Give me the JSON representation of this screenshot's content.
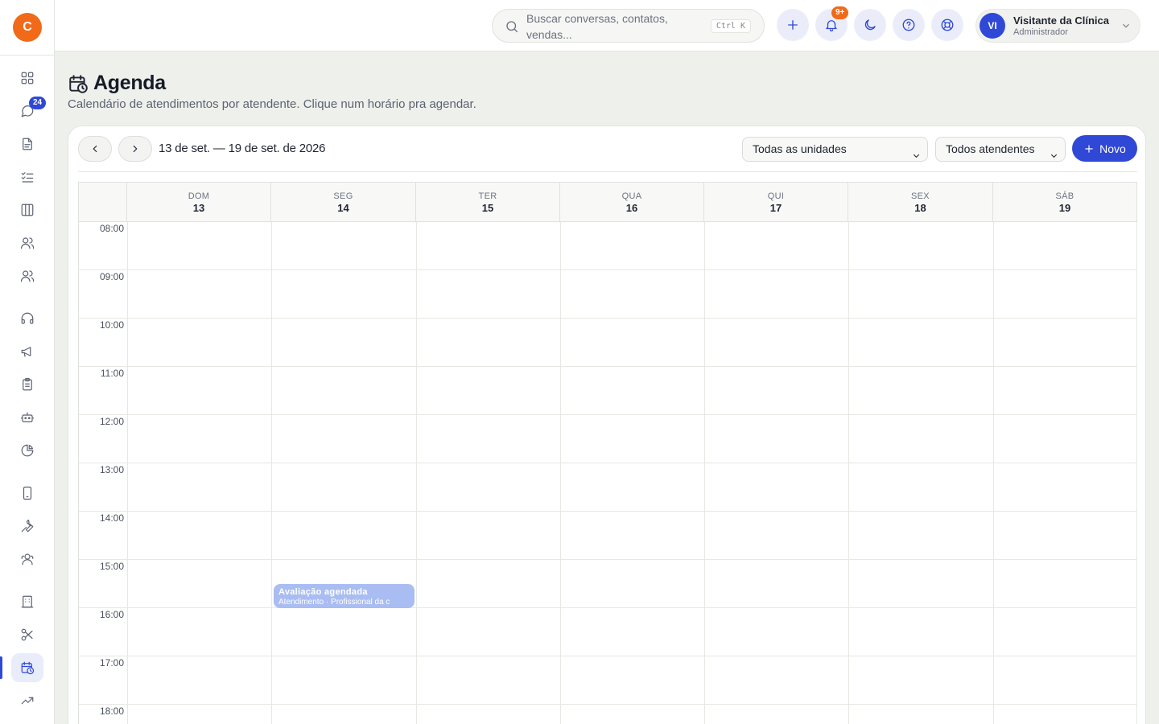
{
  "sidebar": {
    "logo_letter": "C",
    "chat_badge": "24",
    "items": [
      {
        "icon": "dashboard-icon"
      },
      {
        "icon": "chat-icon"
      },
      {
        "icon": "document-icon"
      },
      {
        "icon": "checklist-icon"
      },
      {
        "icon": "kanban-icon"
      },
      {
        "icon": "contacts-icon"
      },
      {
        "icon": "team-icon"
      },
      {
        "icon": "headset-icon"
      },
      {
        "icon": "megaphone-icon"
      },
      {
        "icon": "clipboard-icon"
      },
      {
        "icon": "robot-icon"
      },
      {
        "icon": "pie-chart-icon"
      },
      {
        "icon": "phone-icon"
      },
      {
        "icon": "wrench-icon"
      },
      {
        "icon": "users-icon"
      },
      {
        "icon": "building-icon"
      },
      {
        "icon": "scissors-icon"
      },
      {
        "icon": "calendar-clock-icon",
        "active": true
      },
      {
        "icon": "trending-icon"
      }
    ]
  },
  "topbar": {
    "search_placeholder": "Buscar conversas, contatos, vendas...",
    "shortcut": "Ctrl K",
    "notif_badge": "9+",
    "user": {
      "initials": "VI",
      "name": "Visitante da Clínica",
      "role": "Administrador"
    }
  },
  "page": {
    "title": "Agenda",
    "subtitle": "Calendário de atendimentos por atendente. Clique num horário pra agendar."
  },
  "toolbar": {
    "range": "13 de set. — 19 de set. de 2026",
    "unit_select": "Todas as unidades",
    "attendant_select": "Todos atendentes",
    "new_label": "Novo"
  },
  "calendar": {
    "days": [
      {
        "name": "DOM",
        "num": "13"
      },
      {
        "name": "SEG",
        "num": "14"
      },
      {
        "name": "TER",
        "num": "15"
      },
      {
        "name": "QUA",
        "num": "16"
      },
      {
        "name": "QUI",
        "num": "17"
      },
      {
        "name": "SEX",
        "num": "18"
      },
      {
        "name": "SÁB",
        "num": "19"
      }
    ],
    "hours": [
      "08:00",
      "09:00",
      "10:00",
      "11:00",
      "12:00",
      "13:00",
      "14:00",
      "15:00",
      "16:00",
      "17:00",
      "18:00"
    ],
    "event": {
      "title": "Avaliação agendada",
      "subtitle": "Atendimento · Profissional da c",
      "color": "#a9bdf2"
    }
  },
  "colors": {
    "accent": "#3048d6",
    "brand": "#f06a1a",
    "background": "#eef0ec"
  }
}
